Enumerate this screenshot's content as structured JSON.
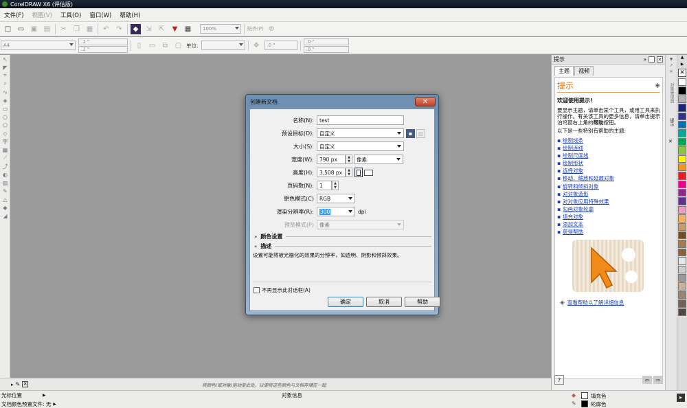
{
  "window": {
    "title": "CorelDRAW X6 (评估版)"
  },
  "menu": [
    {
      "label": "文件(F)",
      "enabled": true
    },
    {
      "label": "视图(V)",
      "enabled": false
    },
    {
      "label": "工具(O)",
      "enabled": true
    },
    {
      "label": "窗口(W)",
      "enabled": true
    },
    {
      "label": "帮助(H)",
      "enabled": true
    }
  ],
  "toolbar": {
    "zoom": "100%",
    "snap": "贴齐(P)"
  },
  "propertybar": {
    "page_size": "A4",
    "width_value": ".1 \"",
    "height_value": ".1 \"",
    "units_label": "单位:",
    "nudge": ".0 \"",
    "dup_x": ".0 \"",
    "dup_y": ".0 \""
  },
  "dialog": {
    "title": "创建新文档",
    "name_label": "名称(N):",
    "name_value": "test",
    "preset_label": "预设目标(D):",
    "preset_value": "自定义",
    "size_label": "大小(S):",
    "size_value": "自定义",
    "width_label": "宽度(W):",
    "width_value": "790 px",
    "width_unit": "像素",
    "height_label": "高度(H):",
    "height_value": "3,508 px",
    "pages_label": "页码数(N):",
    "pages_value": "1",
    "color_mode_label": "原色模式(C)",
    "color_mode_value": "RGB",
    "resolution_label": "渲染分辨率(R):",
    "resolution_value": "300",
    "resolution_unit": "dpi",
    "preview_label": "预览模式(P)",
    "preview_value": "像素",
    "color_settings": "颜色设置",
    "description_heading": "描述",
    "description_text": "设置可能将被光栅化的效果的分辨率，如透明、阴影和倾斜效果。",
    "dont_show_label": "不再显示此对话框(A)",
    "ok": "确定",
    "cancel": "取消",
    "help": "帮助"
  },
  "docker": {
    "title": "提示",
    "tabs": [
      "主题",
      "视频"
    ],
    "heading": "提示",
    "welcome": "欢迎使用提示!",
    "intro_1": "要显示主题，请单击某个工具，或用工具来执行操作。有关该工具的更多信息，请单击提示泊坞窗右上角的",
    "intro_bold": "帮助",
    "intro_2": "按钮。",
    "list_intro": "以下是一些特别有帮助的主题:",
    "topics": [
      "绘制线条",
      "绘制连线",
      "绘制尺度线",
      "绘制形状",
      "选择对象",
      "移动、缩放和延展对象",
      "旋转和倾斜对象",
      "对对象造形",
      "对对象应用特殊效果",
      "勾画对象轮廓",
      "填充对象",
      "添加文本",
      "获得帮助"
    ],
    "more_help": "查看帮助以了解详细信息"
  },
  "side_tabs": [
    "对象管理器",
    "提示"
  ],
  "palette_colors": [
    "#ffffff",
    "#000000",
    "#b3b3b3",
    "#1a237e",
    "#2e3192",
    "#0072bc",
    "#00a99d",
    "#00a651",
    "#8dc63f",
    "#fff200",
    "#f7941d",
    "#ed1c24",
    "#ec008c",
    "#92278f",
    "#662d91",
    "#f49ac1",
    "#fbaf5d",
    "#c69c6d",
    "#754c24",
    "#a67c52",
    "#8c6239",
    "#e6e6e6",
    "#cccccc",
    "#999999",
    "#c7b299",
    "#998675",
    "#736357",
    "#534741"
  ],
  "bottom": {
    "hint": "将颜色(或对象)拖动至此处，以便将这些颜色与文档存储在一起"
  },
  "status": {
    "cursor_label": "光标位置",
    "doc_color": "文档颜色预置文件: 无",
    "object_info": "对象信息",
    "fill_label": "填充色",
    "outline_label": "轮廓色"
  }
}
